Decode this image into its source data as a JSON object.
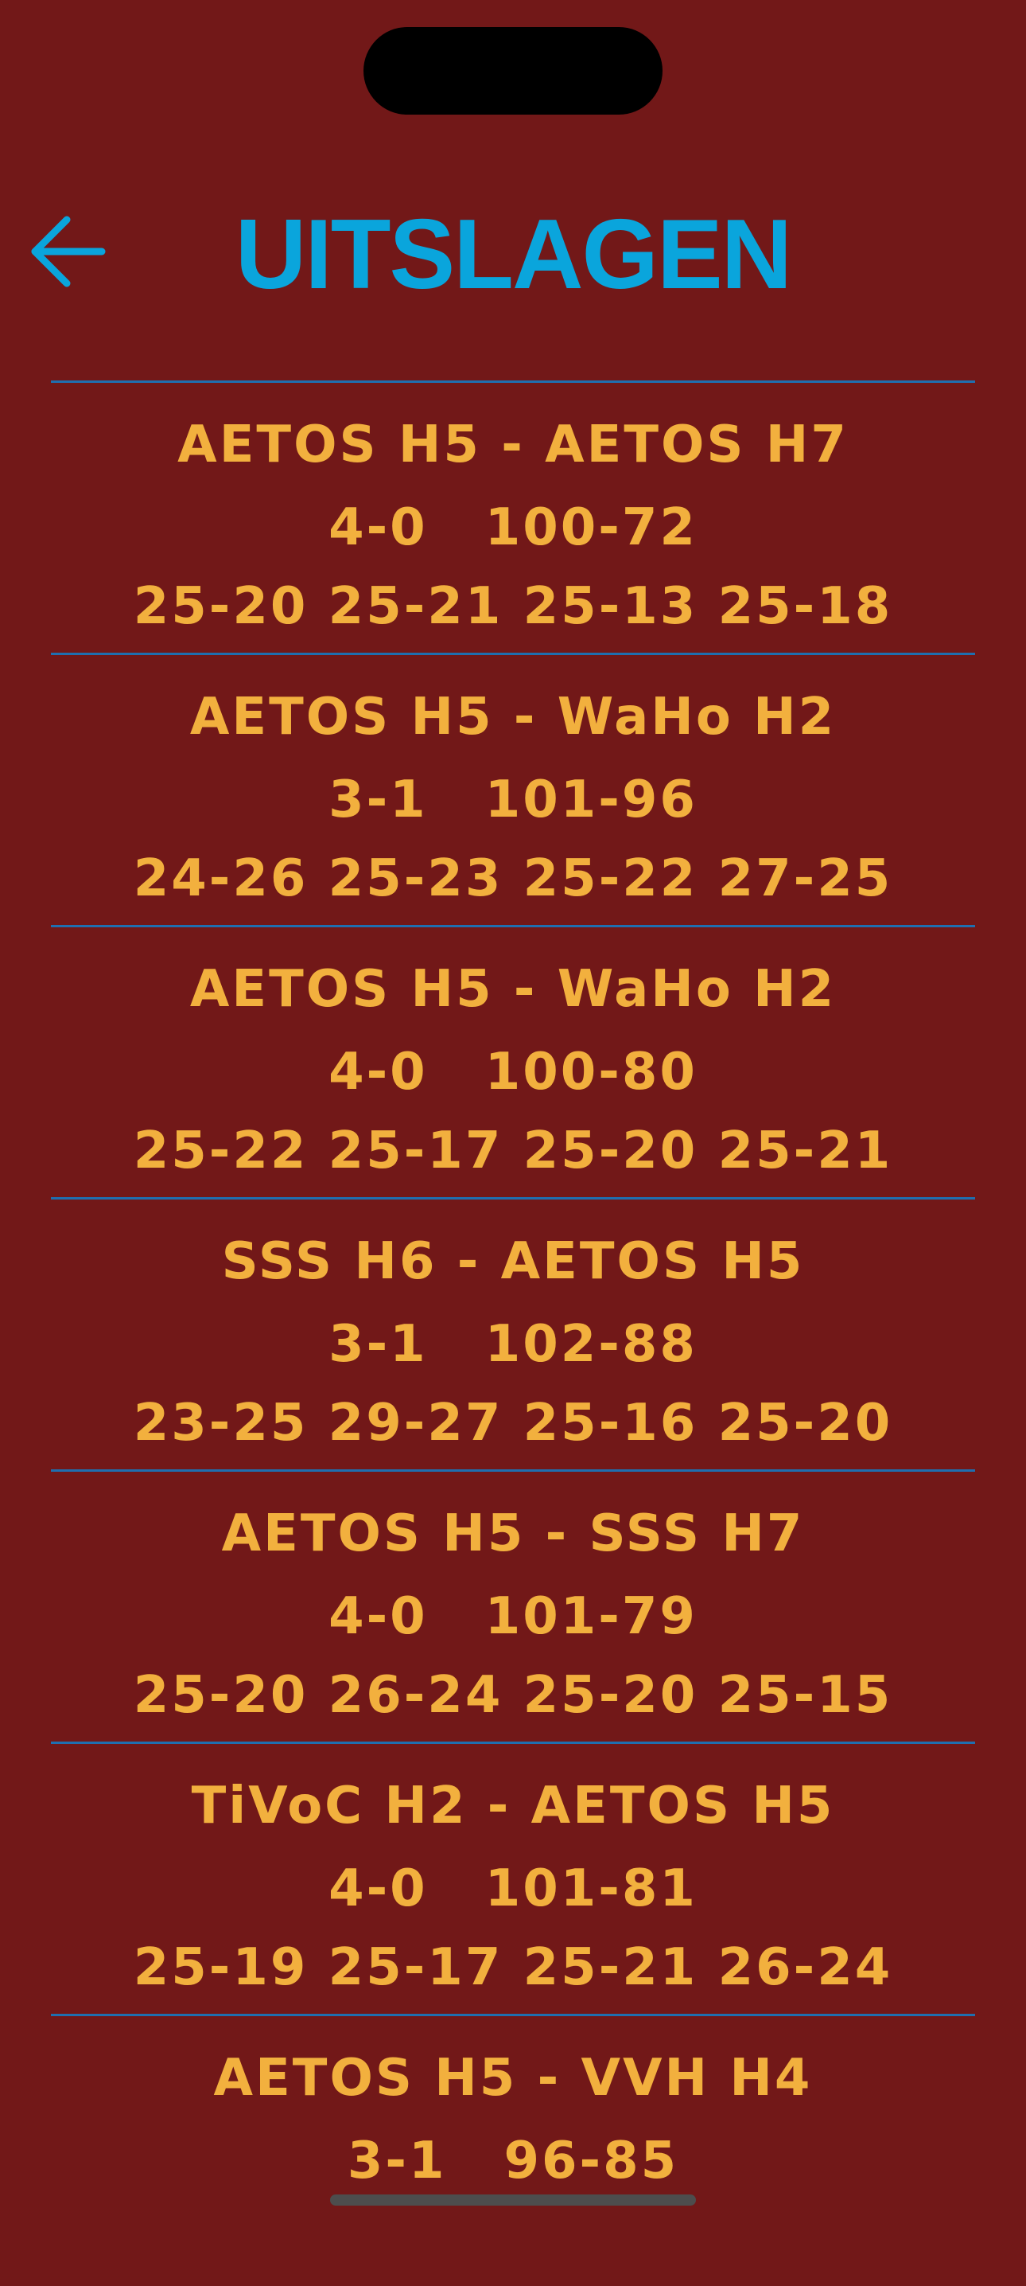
{
  "colors": {
    "background": "#721818",
    "title": "#0aa5dc",
    "back_arrow": "#0aa5dc",
    "result_text": "#f2b03e",
    "divider": "#1f6fb0"
  },
  "header": {
    "back_icon": "arrow-left-icon",
    "title": "UITSLAGEN"
  },
  "results": [
    {
      "match": "AETOS H5 - AETOS H7",
      "sets": "4-0",
      "points": "100-72",
      "set_scores": "25-20 25-21 25-13 25-18"
    },
    {
      "match": "AETOS H5 - WaHo H2",
      "sets": "3-1",
      "points": "101-96",
      "set_scores": "24-26 25-23 25-22 27-25"
    },
    {
      "match": "AETOS H5 - WaHo H2",
      "sets": "4-0",
      "points": "100-80",
      "set_scores": "25-22 25-17 25-20 25-21"
    },
    {
      "match": "SSS H6 - AETOS H5",
      "sets": "3-1",
      "points": "102-88",
      "set_scores": "23-25 29-27 25-16 25-20"
    },
    {
      "match": "AETOS H5 - SSS H7",
      "sets": "4-0",
      "points": "101-79",
      "set_scores": "25-20 26-24 25-20 25-15"
    },
    {
      "match": "TiVoC H2 - AETOS H5",
      "sets": "4-0",
      "points": "101-81",
      "set_scores": "25-19 25-17 25-21 26-24"
    },
    {
      "match": "AETOS H5 - VVH H4",
      "sets": "3-1",
      "points": "96-85",
      "set_scores": ""
    }
  ]
}
